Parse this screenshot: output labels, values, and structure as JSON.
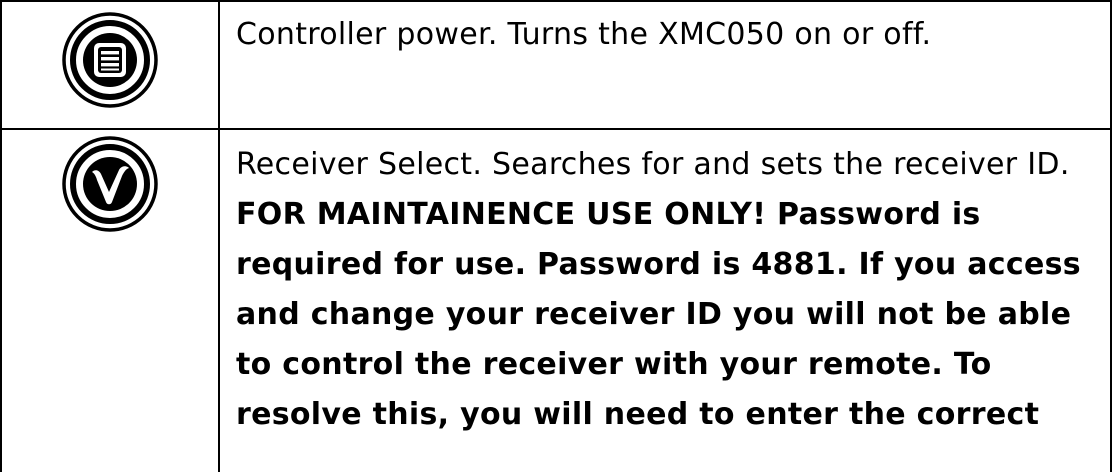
{
  "rows": [
    {
      "icon": "controller-power-icon",
      "text": "Controller power. Turns the XMC050 on or off."
    },
    {
      "icon": "receiver-select-icon",
      "text": "Receiver Select. Searches for and sets the receiver ID. ",
      "bold_text": "FOR MAINTAINENCE USE ONLY! Password is required for use. Password is 4881. If you access and change your receiver ID you will not be able to control the receiver with your remote. To resolve this, you will need to enter the correct"
    }
  ]
}
